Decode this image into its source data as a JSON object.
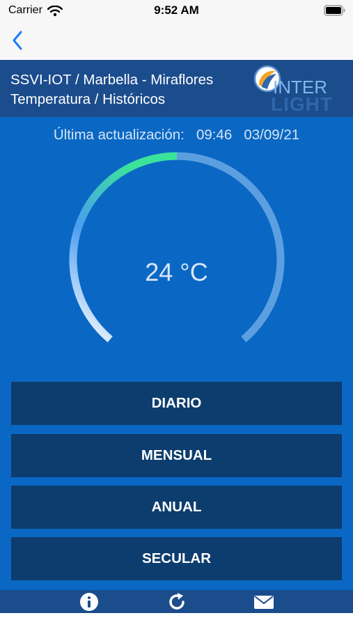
{
  "status_bar": {
    "carrier": "Carrier",
    "time": "9:52 AM"
  },
  "nav": {
    "back_icon": "chevron-left-icon"
  },
  "header": {
    "title_line1": "SSVI-IOT / Marbella - Miraflores",
    "title_line2": "Temperatura / Históricos",
    "logo_top": "INTER",
    "logo_bottom": "LIGHT"
  },
  "update": {
    "label": "Última actualización:",
    "time": "09:46",
    "date": "03/09/21"
  },
  "gauge": {
    "value_text": "24 °C",
    "fill_fraction": 0.5
  },
  "buttons": {
    "daily": "DIARIO",
    "monthly": "MENSUAL",
    "yearly": "ANUAL",
    "secular": "SECULAR"
  },
  "toolbar": {
    "info_icon": "info-icon",
    "refresh_icon": "refresh-icon",
    "mail_icon": "mail-icon"
  },
  "colors": {
    "header": "#1b4c8c",
    "main": "#0a68c4",
    "button": "#0d3d6e",
    "gauge_track": "#5c9fe0",
    "gauge_start": "#ffffff",
    "gauge_mid": "#4a9cf0",
    "gauge_end": "#3ae39a"
  }
}
